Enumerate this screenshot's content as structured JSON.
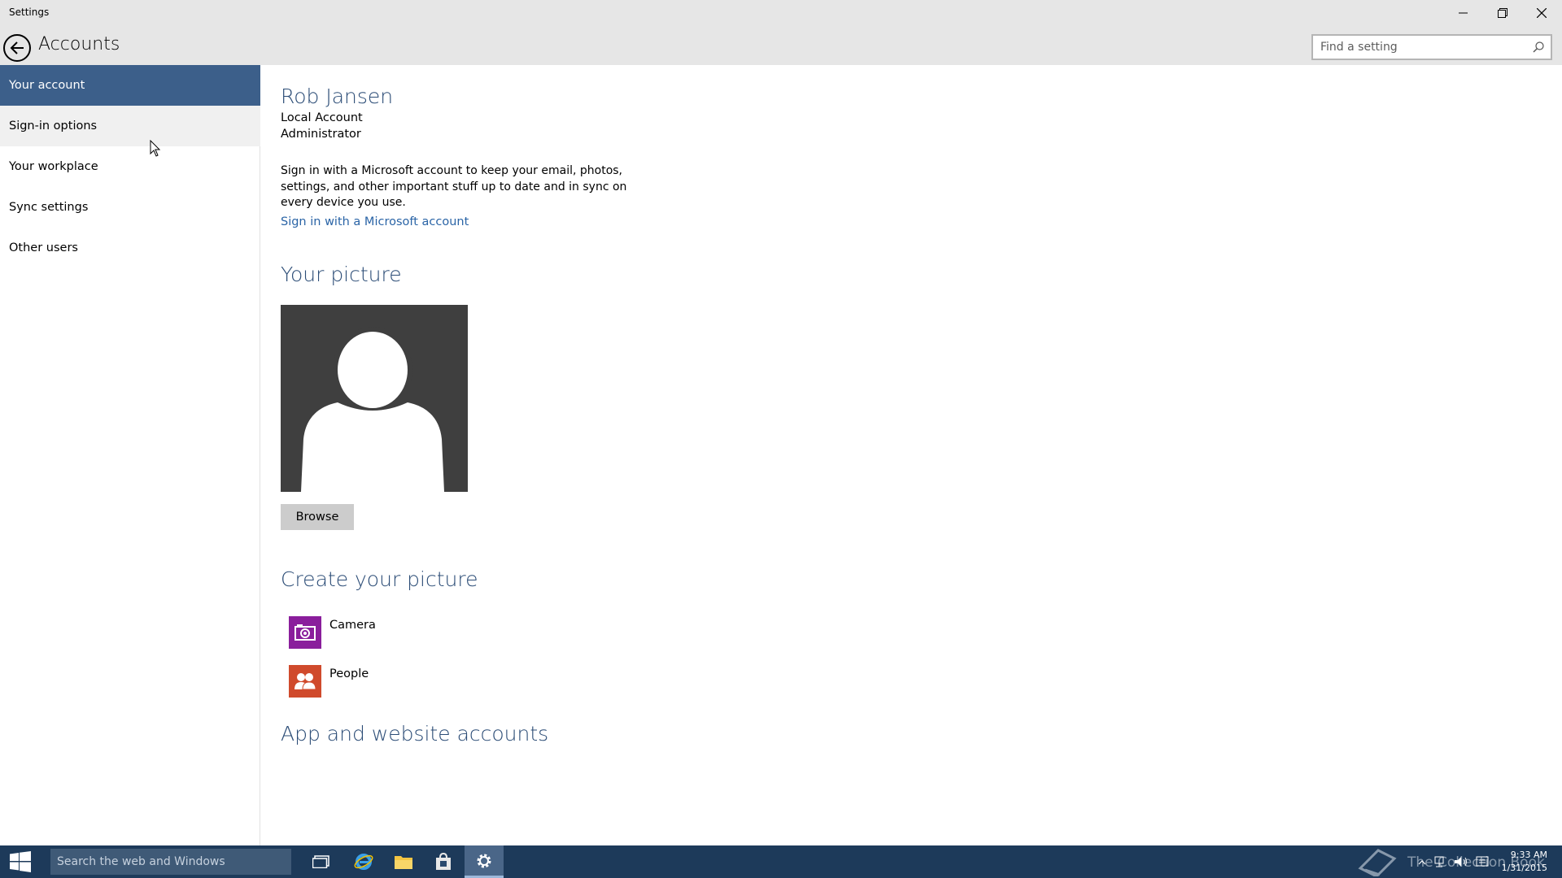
{
  "window": {
    "title": "Settings"
  },
  "header": {
    "page_title": "Accounts",
    "search_placeholder": "Find a setting"
  },
  "nav": {
    "items": [
      {
        "label": "Your account",
        "state": "selected"
      },
      {
        "label": "Sign-in options",
        "state": "hover"
      },
      {
        "label": "Your workplace",
        "state": "normal"
      },
      {
        "label": "Sync settings",
        "state": "normal"
      },
      {
        "label": "Other users",
        "state": "normal"
      }
    ]
  },
  "account": {
    "name": "Rob Jansen",
    "type": "Local Account",
    "role": "Administrator",
    "description": "Sign in with a Microsoft account to keep your email, photos, settings, and other important stuff up to date and in sync on every device you use.",
    "link": "Sign in with a Microsoft account"
  },
  "picture": {
    "section_title": "Your picture",
    "browse_label": "Browse"
  },
  "create_picture": {
    "section_title": "Create your picture",
    "options": [
      {
        "label": "Camera",
        "icon": "camera-icon",
        "color": "#8a1e9c"
      },
      {
        "label": "People",
        "icon": "people-icon",
        "color": "#d04a2c"
      }
    ]
  },
  "app_accounts": {
    "section_title": "App and website accounts"
  },
  "taskbar": {
    "search_placeholder": "Search the web and Windows",
    "watermark": "The Collection Book",
    "time": "9:33 AM",
    "date": "1/31/2015"
  },
  "colors": {
    "accent": "#3c5f8a",
    "heading": "#2b4c76",
    "link": "#2a64a6",
    "taskbar": "#1d3a5a"
  }
}
